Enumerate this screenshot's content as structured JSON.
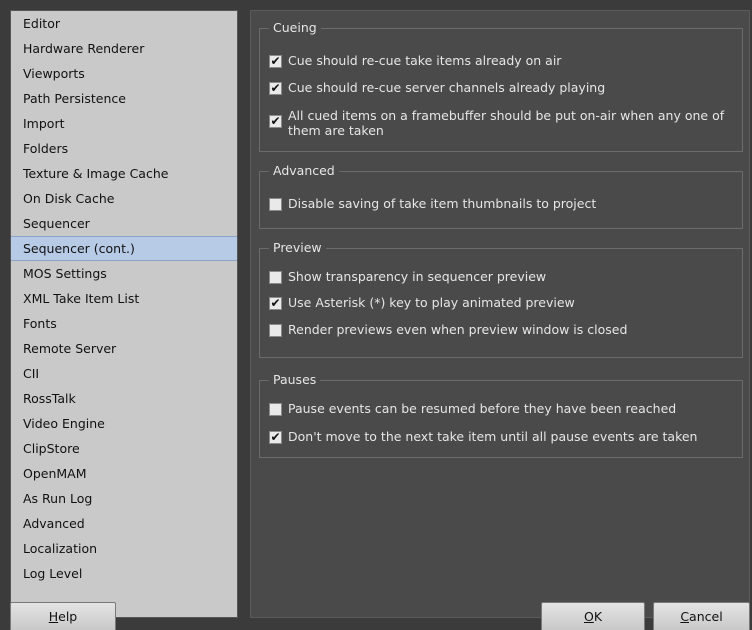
{
  "categories": [
    "Editor",
    "Hardware Renderer",
    "Viewports",
    "Path Persistence",
    "Import",
    "Folders",
    "Texture & Image Cache",
    "On Disk Cache",
    "Sequencer",
    "Sequencer (cont.)",
    "MOS Settings",
    "XML Take Item List",
    "Fonts",
    "Remote Server",
    "CII",
    "RossTalk",
    "Video Engine",
    "ClipStore",
    "OpenMAM",
    "As Run Log",
    "Advanced",
    "Localization",
    "Log Level"
  ],
  "selected_category": "Sequencer (cont.)",
  "groups": {
    "cueing": {
      "title": "Cueing",
      "options": [
        {
          "label": "Cue should re-cue take items already on air",
          "checked": true
        },
        {
          "label": "Cue should re-cue server channels already playing",
          "checked": true
        },
        {
          "label": "All cued items on a framebuffer should be put on-air when any one of them are taken",
          "checked": true
        }
      ]
    },
    "advanced": {
      "title": "Advanced",
      "options": [
        {
          "label": "Disable saving of take item thumbnails to project",
          "checked": false
        }
      ]
    },
    "preview": {
      "title": "Preview",
      "options": [
        {
          "label": "Show transparency in sequencer preview",
          "checked": false
        },
        {
          "label": "Use Asterisk (*) key to play animated preview",
          "checked": true
        },
        {
          "label": "Render previews even when preview window is closed",
          "checked": false
        }
      ]
    },
    "pauses": {
      "title": "Pauses",
      "options": [
        {
          "label": "Pause events can be resumed before they have been reached",
          "checked": false
        },
        {
          "label": "Don't move to the next take item until all pause events are taken",
          "checked": true
        }
      ]
    }
  },
  "buttons": {
    "help": {
      "mnemonic": "H",
      "rest": "elp"
    },
    "ok": {
      "mnemonic": "O",
      "rest": "K"
    },
    "cancel": {
      "mnemonic": "C",
      "rest": "ancel"
    }
  },
  "check_glyph": "✔"
}
